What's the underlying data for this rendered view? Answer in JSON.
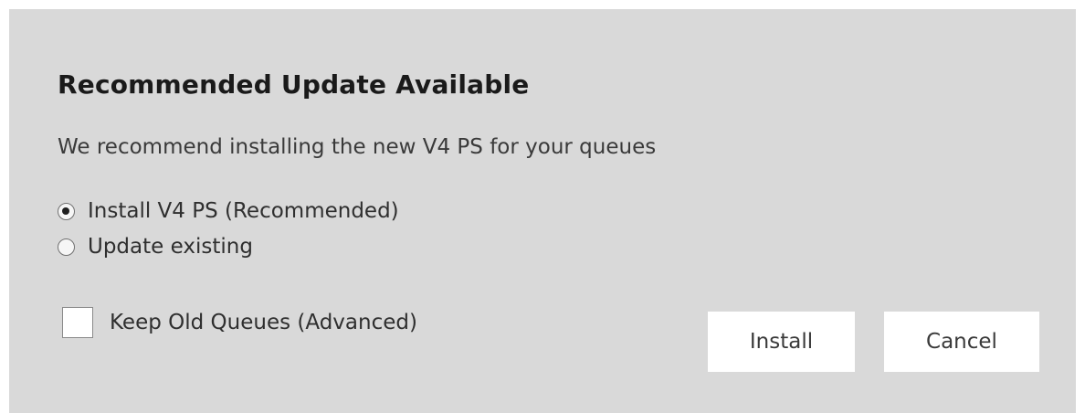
{
  "dialog": {
    "title": "Recommended Update Available",
    "message": "We recommend installing the new V4 PS for your queues",
    "options": [
      {
        "label": "Install V4 PS (Recommended)",
        "selected": true
      },
      {
        "label": "Update existing",
        "selected": false
      }
    ],
    "checkbox": {
      "label": "Keep Old Queues (Advanced)",
      "checked": false
    },
    "buttons": {
      "install": "Install",
      "cancel": "Cancel"
    }
  }
}
